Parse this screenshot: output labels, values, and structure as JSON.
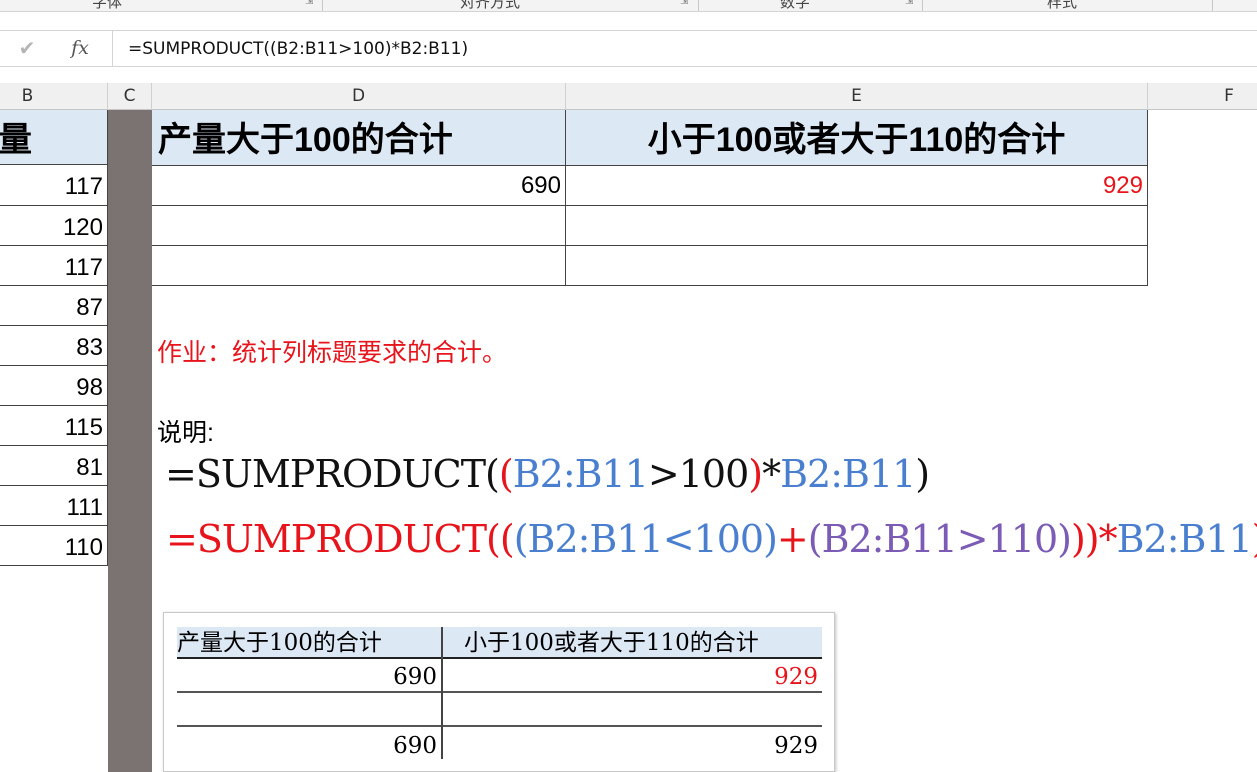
{
  "ribbon": {
    "groups": [
      "字体",
      "对齐方式",
      "数字",
      "样式"
    ]
  },
  "formula_bar": {
    "cancel_icon": "check-icon",
    "fx_label": "fx",
    "formula": "=SUMPRODUCT((B2:B11>100)*B2:B11)"
  },
  "columns": [
    "B",
    "C",
    "D",
    "E",
    "F"
  ],
  "column_b": {
    "header_partial": "量",
    "values": [
      "117",
      "120",
      "117",
      "87",
      "83",
      "98",
      "115",
      "81",
      "111",
      "110"
    ]
  },
  "main_table": {
    "header_d": "产量大于100的合计",
    "header_e": "小于100或者大于110的合计",
    "row1_d": "690",
    "row1_e": "929"
  },
  "notes": {
    "homework": "作业：统计列标题要求的合计。",
    "explanation": "说明:"
  },
  "formula_display_1": {
    "p1": "=SUMPRODUCT(",
    "p2": "(",
    "p3": "B2:B11",
    "p4": ">100",
    "p5": ")",
    "p6": "*",
    "p7": "B2:B11",
    "p8": ")"
  },
  "formula_display_2": {
    "p1": "=SUMPRODUCT((",
    "p2": "(B2:B11<100)",
    "p3": "+",
    "p4": "(B2:B11>110)",
    "p5": "))*",
    "p6": "B2:B11",
    "p7": ")"
  },
  "embedded_table": {
    "header_left": "产量大于100的合计",
    "header_right": "小于100或者大于110的合计",
    "row1_left": "690",
    "row1_right": "929",
    "row3_left": "690",
    "row3_right": "929"
  },
  "colors": {
    "header_fill": "#dce9f5",
    "red": "#e8141c",
    "blue": "#4a7fd0",
    "purple": "#7b5bb5",
    "gray_column": "#7a7372"
  }
}
